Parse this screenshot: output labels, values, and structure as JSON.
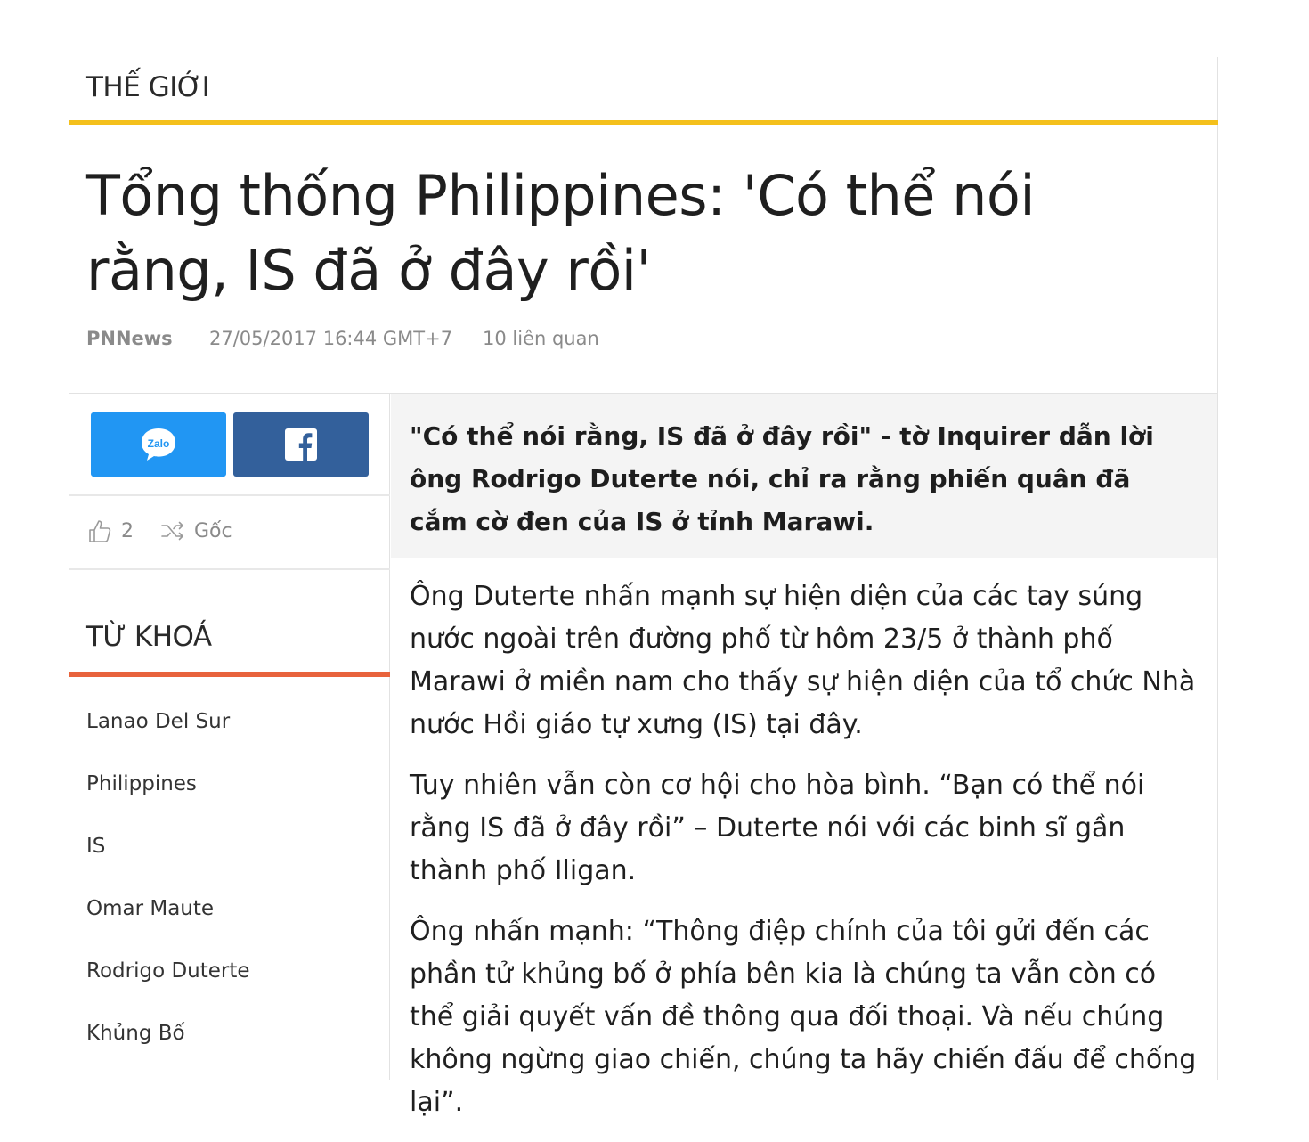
{
  "section": {
    "title": "THẾ GIỚI"
  },
  "article": {
    "headline": "Tổng thống Philippines: 'Có thể nói rằng, IS đã ở đây rồi'",
    "meta": {
      "source": "PNNews",
      "date": "27/05/2017 16:44 GMT+7",
      "related": "10 liên quan"
    },
    "lede": "\"Có thể nói rằng, IS đã ở đây rồi\" - tờ Inquirer dẫn lời ông Rodrigo Duterte nói, chỉ ra rằng phiến quân đã cắm cờ đen của IS ở tỉnh Marawi.",
    "paragraphs": [
      "Ông Duterte nhấn mạnh sự hiện diện của các tay súng nước ngoài trên đường phố từ hôm 23/5 ở thành phố Marawi ở miền nam cho thấy sự hiện diện của tổ chức Nhà nước Hồi giáo tự xưng (IS) tại đây.",
      "Tuy nhiên vẫn còn cơ hội cho hòa bình. “Bạn có thể nói rằng IS đã ở đây rồi” – Duterte nói với các binh sĩ gần thành phố Iligan.",
      "Ông nhấn mạnh: “Thông điệp chính của tôi gửi đến các phần tử khủng bố ở phía bên kia là chúng ta vẫn còn có thể giải quyết vấn đề thông qua đối thoại. Và nếu chúng không ngừng giao chiến, chúng ta hãy chiến đấu để chống lại”."
    ]
  },
  "share": {
    "zalo_label": "Zalo",
    "zalo_color": "#2196f3",
    "facebook_color": "#33609b"
  },
  "stats": {
    "likes": "2",
    "original_label": "Gốc"
  },
  "keywords": {
    "title": "TỪ KHOÁ",
    "items": [
      "Lanao Del Sur",
      "Philippines",
      "IS",
      "Omar Maute",
      "Rodrigo Duterte",
      "Khủng Bố"
    ]
  },
  "colors": {
    "section_underline": "#f4c01c",
    "keyword_underline": "#e8633c"
  }
}
